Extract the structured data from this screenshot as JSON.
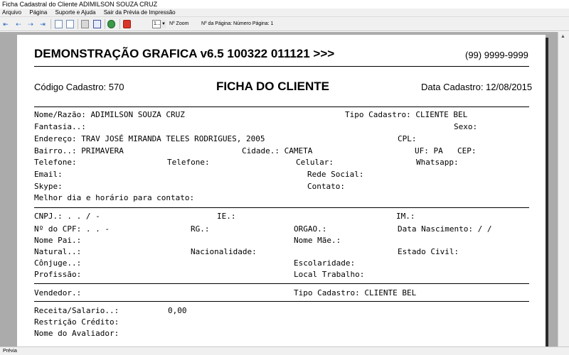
{
  "window": {
    "title": "Ficha Cadastral do Cliente ADIMILSON SOUZA CRUZ"
  },
  "menu": [
    "Arquivo",
    "Página",
    "Suporte e Ajuda",
    "Sair da Prévia de Impressão"
  ],
  "toolbar": {
    "zoom_value": "1...",
    "zoom_label": "Nº Zoom",
    "page_label": "Nº da Página: Número Página: 1"
  },
  "report": {
    "title": "DEMONSTRAÇÃO GRAFICA v6.5 100322 011121 >>>",
    "phone": "(99) 9999-9999",
    "codigo": "Código Cadastro:   570",
    "ficha": "FICHA DO CLIENTE",
    "data_cadastro": "Data Cadastro: 12/08/2015",
    "nome": "Nome/Razão: ADIMILSON SOUZA CRUZ",
    "tipo_cadastro_1": "Tipo Cadastro: CLIENTE BEL",
    "fantasia": "Fantasia..:",
    "sexo": "Sexo:",
    "endereco": "Endereço: TRAV JOSÉ MIRANDA TELES RODRIGUES, 2005",
    "cpl": "CPL:",
    "bairro": "Bairro..: PRIMAVERA",
    "cidade": "Cidade.: CAMETA",
    "uf": "UF: PA",
    "cep": "CEP:",
    "telefone1": "Telefone:",
    "telefone2": "Telefone:",
    "celular": "Celular:",
    "whatsapp": "Whatsapp:",
    "email": "Email:",
    "rede_social": "Rede Social:",
    "skype": "Skype:",
    "contato": "Contato:",
    "melhor_dia": "Melhor dia e horário para contato:",
    "cnpj": "CNPJ.:   .   .   /   -",
    "ie": "IE.:",
    "im": "IM.:",
    "cpf": "Nº do CPF:    .   .   -",
    "rg": "RG.:",
    "orgao": "ORGAO.:",
    "data_nasc": "Data Nascimento:   /  /",
    "nome_pai": "Nome Pai.:",
    "nome_mae": "Nome Mãe.:",
    "natural": "Natural..:",
    "nacionalidade": "Nacionalidade:",
    "estado_civil": "Estado Civil:",
    "conjuge": "Cônjuge..:",
    "escolaridade": "Escolaridade:",
    "profissao": "Profissão:",
    "local_trabalho": "Local Trabalho:",
    "vendedor": "Vendedor.:",
    "tipo_cadastro_2": "Tipo Cadastro: CLIENTE BEL",
    "receita": "Receita/Salario..:",
    "receita_valor": "0,00",
    "restricao": "Restrição Crédito:",
    "avaliador": "Nome do Avaliador:"
  },
  "status": {
    "text": "Prévia"
  },
  "colors": {
    "workspace": "#ababab",
    "toolbar": "#f0f0f0",
    "paper": "#ffffff",
    "accent": "#1f5fbf"
  }
}
